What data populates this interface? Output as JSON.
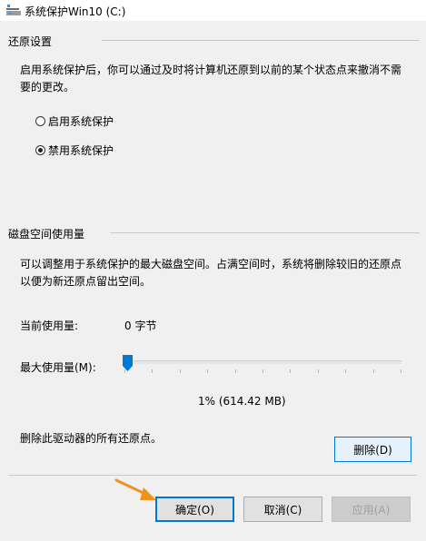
{
  "window": {
    "title": "系统保护Win10 (C:)"
  },
  "restore": {
    "header": "还原设置",
    "description_line1": "启用系统保护后，你可以通过及时将计算机还原到以前的某个状态点来撤消不需",
    "description_line2": "要的更改。",
    "options": [
      {
        "label": "启用系统保护",
        "checked": false
      },
      {
        "label": "禁用系统保护",
        "checked": true
      }
    ]
  },
  "disk": {
    "header": "磁盘空间使用量",
    "description_line1": "可以调整用于系统保护的最大磁盘空间。占满空间时，系统将删除较旧的还原点",
    "description_line2": "以便为新还原点留出空间。",
    "current_usage_label": "当前使用量:",
    "current_usage_value": "0 字节",
    "max_usage_label": "最大使用量(M):",
    "max_usage_fraction": 0.01,
    "max_usage_value": "1% (614.42 MB)",
    "delete_text": "删除此驱动器的所有还原点。",
    "delete_button": "删除(D)"
  },
  "footer": {
    "ok": "确定(O)",
    "cancel": "取消(C)",
    "apply": "应用(A)"
  },
  "colors": {
    "accent": "#0078d7",
    "annotation_arrow": "#f0921e"
  }
}
